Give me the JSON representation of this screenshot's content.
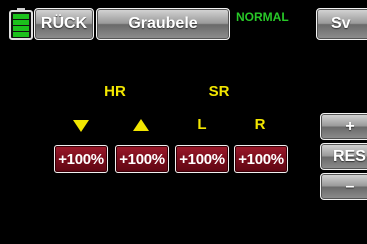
{
  "header": {
    "back_label": "RÜCK",
    "model_name": "Graubele",
    "phase_label": "NORMAL",
    "right_button_label": "Sv"
  },
  "groups": {
    "hr_label": "HR",
    "sr_label": "SR"
  },
  "columns": [
    {
      "indicator": "▼",
      "value": "+100%"
    },
    {
      "indicator": "▲",
      "value": "+100%"
    },
    {
      "indicator": "L",
      "value": "+100%"
    },
    {
      "indicator": "R",
      "value": "+100%"
    }
  ],
  "side_buttons": {
    "plus_label": "+",
    "res_label": "RES",
    "minus_label": "–"
  },
  "battery": {
    "level": 0.85
  },
  "colors": {
    "accent_yellow": "#f2e600",
    "phase_green": "#28c828",
    "value_red": "#7a0d1c",
    "battery_green": "#1cc21c"
  }
}
